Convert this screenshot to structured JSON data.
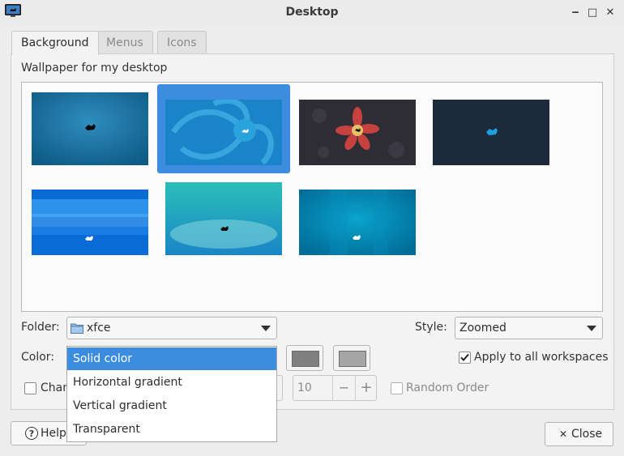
{
  "window": {
    "title": "Desktop"
  },
  "titlebar": {
    "minimize_glyph": "‒",
    "maximize_glyph": "□",
    "close_glyph": "✕"
  },
  "tabs": [
    {
      "label": "Background",
      "active": true
    },
    {
      "label": "Menus",
      "active": false
    },
    {
      "label": "Icons",
      "active": false
    }
  ],
  "wallpaper": {
    "label": "Wallpaper for my desktop",
    "selected_index": 1,
    "thumbnails": [
      {
        "name": "xfce-blue-mouse",
        "colors": [
          "#0e5b86",
          "#2f8dbd"
        ]
      },
      {
        "name": "xfce-swirl",
        "colors": [
          "#1b83c8",
          "#32b6ea"
        ]
      },
      {
        "name": "xfce-flower",
        "colors": [
          "#2a2a33",
          "#3a3842"
        ]
      },
      {
        "name": "xfce-dark-blue-mouse",
        "colors": [
          "#192838",
          "#22364a"
        ]
      },
      {
        "name": "xfce-stripes",
        "colors": [
          "#0a6bd6",
          "#3aa3f5"
        ]
      },
      {
        "name": "xfce-teal",
        "colors": [
          "#2bbfb9",
          "#1985c6"
        ]
      },
      {
        "name": "xfce-teal-dark",
        "colors": [
          "#006c98",
          "#0aa4cc"
        ]
      }
    ]
  },
  "folder": {
    "label": "Folder:",
    "value": "xfce"
  },
  "style": {
    "label": "Style:",
    "value": "Zoomed"
  },
  "color": {
    "label": "Color:",
    "options": [
      "Solid color",
      "Horizontal gradient",
      "Vertical gradient",
      "Transparent"
    ],
    "selected": "Solid color",
    "color1": "#808080",
    "color2": "#a6a6a6"
  },
  "apply_all": {
    "label": "Apply to all workspaces",
    "checked": true
  },
  "change": {
    "label_partial": "Chan",
    "checked": false
  },
  "interval": {
    "value": "10",
    "minus": "−",
    "plus": "+"
  },
  "random_order": {
    "label": "Random Order",
    "checked": false
  },
  "buttons": {
    "help": "Help",
    "close": "Close"
  },
  "accent": "#3c8de0"
}
